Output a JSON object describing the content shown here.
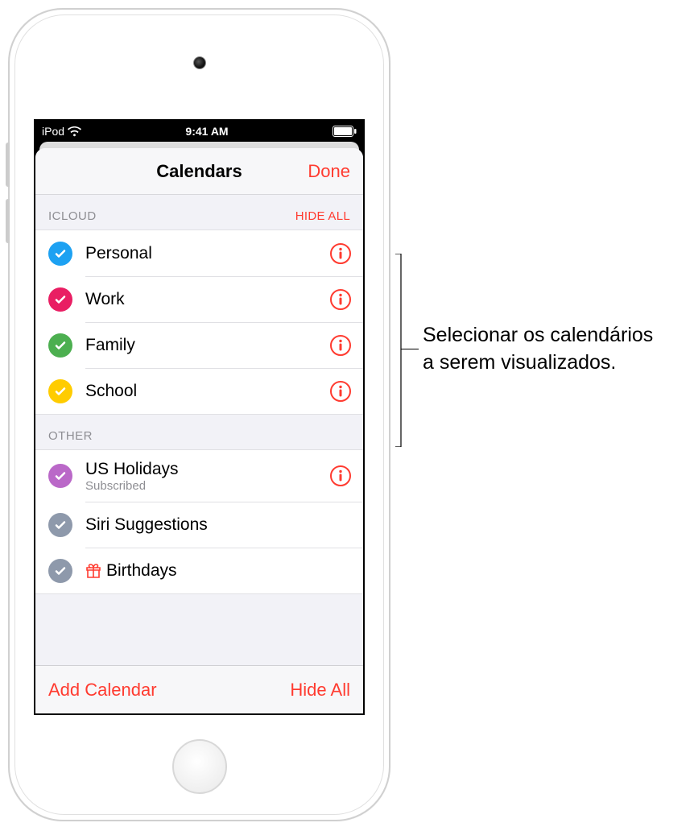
{
  "status": {
    "carrier": "iPod",
    "time": "9:41 AM"
  },
  "header": {
    "title": "Calendars",
    "done": "Done"
  },
  "sections": {
    "icloud": {
      "title": "ICLOUD",
      "hide": "HIDE ALL",
      "items": [
        {
          "label": "Personal",
          "color": "#1da1f2"
        },
        {
          "label": "Work",
          "color": "#e91e63"
        },
        {
          "label": "Family",
          "color": "#4caf50"
        },
        {
          "label": "School",
          "color": "#ffcc00"
        }
      ]
    },
    "other": {
      "title": "OTHER",
      "items": [
        {
          "label": "US Holidays",
          "sub": "Subscribed",
          "color": "#ba68c8",
          "info": true
        },
        {
          "label": "Siri Suggestions",
          "color": "#8e99ab",
          "info": false
        },
        {
          "label": "Birthdays",
          "color": "#8e99ab",
          "icon": "gift",
          "info": false
        }
      ]
    }
  },
  "toolbar": {
    "add": "Add Calendar",
    "hideAll": "Hide All"
  },
  "annotation": {
    "line1": "Selecionar os calendários",
    "line2": "a serem visualizados."
  }
}
